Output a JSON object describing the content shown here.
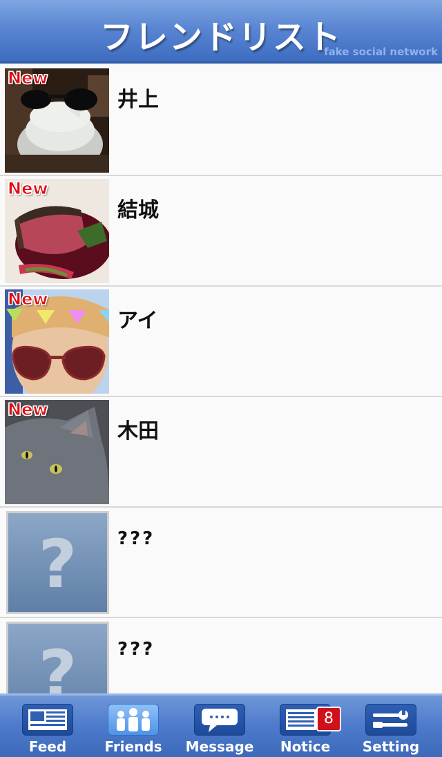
{
  "header": {
    "title": "フレンドリスト",
    "brand": "fake social network"
  },
  "friends": [
    {
      "name": "井上",
      "new_badge": "New",
      "avatar": "teapot-with-sunglasses-photo"
    },
    {
      "name": "結城",
      "new_badge": "New",
      "avatar": "roast-beef-photo"
    },
    {
      "name": "アイ",
      "new_badge": "New",
      "avatar": "person-with-heart-sunglasses-photo"
    },
    {
      "name": "木田",
      "new_badge": "New",
      "avatar": "gray-cat-photo"
    },
    {
      "name": "???",
      "placeholder_glyph": "?",
      "avatar": "unknown-avatar"
    },
    {
      "name": "???",
      "placeholder_glyph": "?",
      "avatar": "unknown-avatar"
    }
  ],
  "tabbar": {
    "tabs": [
      {
        "label": "Feed",
        "icon": "feed-icon",
        "active": false
      },
      {
        "label": "Friends",
        "icon": "friends-icon",
        "active": true
      },
      {
        "label": "Message",
        "icon": "message-icon",
        "active": false
      },
      {
        "label": "Notice",
        "icon": "notice-icon",
        "active": false,
        "badge": "8"
      },
      {
        "label": "Setting",
        "icon": "setting-icon",
        "active": false
      }
    ]
  },
  "colors": {
    "header_blue": "#5a86d3",
    "badge_red": "#d0101b",
    "new_red": "#e00d12"
  }
}
